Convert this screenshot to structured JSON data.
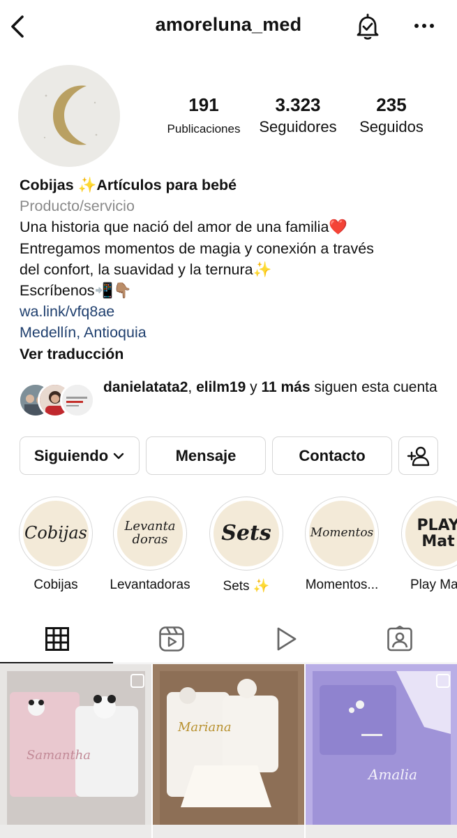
{
  "header": {
    "username": "amoreluna_med",
    "back_icon": "chevron-left-icon",
    "bell_icon": "bell-check-icon",
    "more_icon": "more-horizontal-icon"
  },
  "stats": {
    "posts_count": "191",
    "posts_label": "Publicaciones",
    "followers_count": "3.323",
    "followers_label": "Seguidores",
    "following_count": "235",
    "following_label": "Seguidos"
  },
  "bio": {
    "name": "Cobijas ✨Artículos para bebé",
    "category": "Producto/servicio",
    "lines": [
      "Una historia que nació del amor de una familia❤️",
      "Entregamos momentos de magia y conexión a través",
      "del confort, la suavidad y la ternura✨",
      "Escríbenos📲👇🏽"
    ],
    "link": "wa.link/vfq8ae",
    "location": "Medellín, Antioquia",
    "translate": "Ver traducción"
  },
  "mutual": {
    "user1": "danielatata2",
    "separator1": ",",
    "user2": "elilm19",
    "connector": " y ",
    "more": "11 más",
    "suffix": " siguen esta cuenta"
  },
  "actions": {
    "following": "Siguiendo",
    "message": "Mensaje",
    "contact": "Contacto"
  },
  "highlights": [
    {
      "cover": "Cobijas",
      "label": "Cobijas"
    },
    {
      "cover": "Levanta doras",
      "label": "Levantadoras"
    },
    {
      "cover": "Sets",
      "label": "Sets ✨"
    },
    {
      "cover": "Momentos",
      "label": "Momentos..."
    },
    {
      "cover": "PLAY Mat",
      "label": "Play Ma"
    }
  ],
  "tabs": [
    "grid-icon",
    "reels-icon",
    "play-icon",
    "tagged-icon"
  ],
  "grid": [
    {
      "caption": "Samantha",
      "bg": "#c9c4c2"
    },
    {
      "caption": "Mariana",
      "bg": "#8a6d55"
    },
    {
      "caption": "Amalia",
      "bg": "#9c8fd4"
    }
  ],
  "colors": {
    "link": "#1f3f6e",
    "muted": "#8a8a8a",
    "border": "#d6d6d6",
    "highlight_bg": "#f3ead8"
  }
}
